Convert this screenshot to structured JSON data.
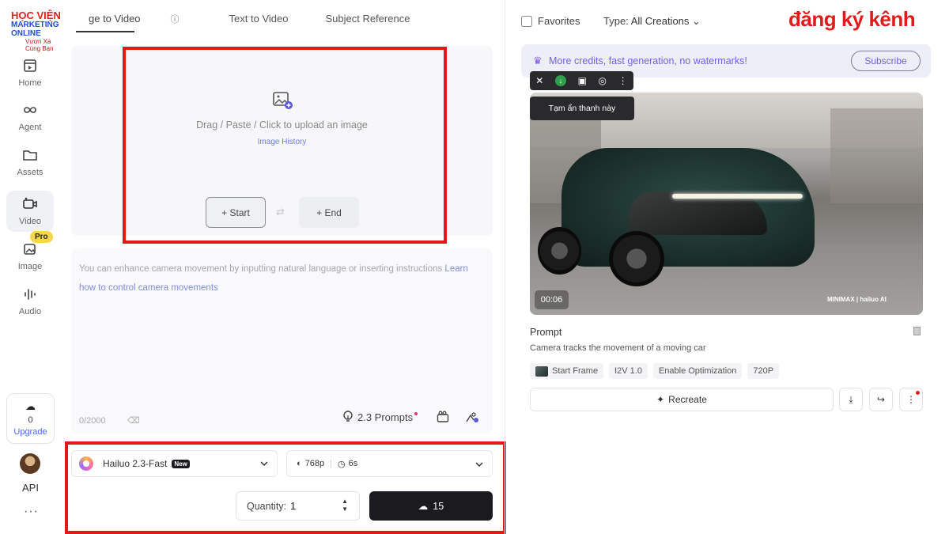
{
  "logo": {
    "line1": "HỌC VIỆN",
    "line2": "MARKETING ONLINE",
    "line3": "Vươn Xa Cùng Bạn"
  },
  "nav": {
    "items": [
      {
        "label": "Home",
        "icon": "home-icon"
      },
      {
        "label": "Agent",
        "icon": "agent-icon"
      },
      {
        "label": "Assets",
        "icon": "folder-icon"
      },
      {
        "label": "Video",
        "icon": "video-icon"
      },
      {
        "label": "Image",
        "icon": "image-icon"
      },
      {
        "label": "Audio",
        "icon": "audio-icon"
      }
    ],
    "pro_badge": "Pro",
    "credits": "0",
    "upgrade_label": "Upgrade",
    "api_label": "API",
    "more": "···"
  },
  "tabs": {
    "items": [
      "ge to Video",
      "Text to Video",
      "Subject Reference"
    ],
    "active_index": 0
  },
  "upload": {
    "text": "Drag / Paste / Click to upload an image",
    "history": "Image History",
    "start_label": "+ Start",
    "end_label": "+ End"
  },
  "prompt": {
    "placeholder_main": "You can enhance camera movement by inputting natural language or inserting instructions ",
    "placeholder_link": "Learn how to control camera movements",
    "counter": "0/2000",
    "prompts_label": "2.3 Prompts"
  },
  "controls": {
    "model_name": "Hailuo 2.3-Fast",
    "model_tag": "New",
    "resolution": "768p",
    "duration": "6s",
    "quantity_label": "Quantity:",
    "quantity_value": "1",
    "generate_cost": "15"
  },
  "right": {
    "favorites_label": "Favorites",
    "type_label": "Type:",
    "type_value": "All Creations",
    "channel_text": "đăng ký kênh",
    "promo_text": "More credits, fast generation, no watermarks!",
    "subscribe_label": "Subscribe",
    "tooltip": "Tạm ẩn thanh này",
    "video_time": "00:06",
    "watermark": "MINIMAX  |  hailuo AI",
    "prompt_title": "Prompt",
    "prompt_text": "Camera tracks the movement of a moving car",
    "tags": [
      "Start Frame",
      "I2V 1.0",
      "Enable Optimization",
      "720P"
    ],
    "recreate_label": "Recreate"
  },
  "colors": {
    "accent": "#7060e6",
    "highlight_red": "#e01919",
    "primary_button": "#1b1b1f"
  }
}
